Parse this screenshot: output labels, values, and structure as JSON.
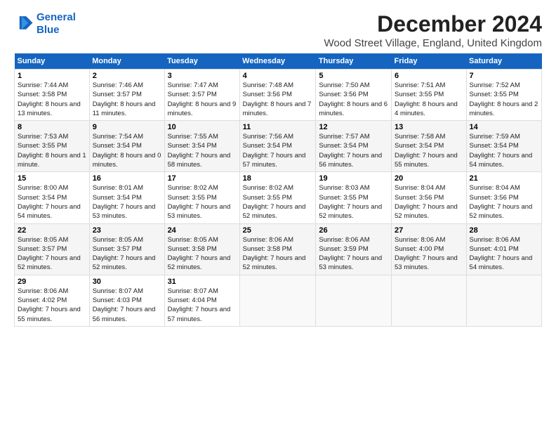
{
  "logo": {
    "line1": "General",
    "line2": "Blue"
  },
  "title": "December 2024",
  "subtitle": "Wood Street Village, England, United Kingdom",
  "days_header": [
    "Sunday",
    "Monday",
    "Tuesday",
    "Wednesday",
    "Thursday",
    "Friday",
    "Saturday"
  ],
  "weeks": [
    [
      {
        "num": "1",
        "sunrise": "7:44 AM",
        "sunset": "3:58 PM",
        "daylight": "8 hours and 13 minutes."
      },
      {
        "num": "2",
        "sunrise": "7:46 AM",
        "sunset": "3:57 PM",
        "daylight": "8 hours and 11 minutes."
      },
      {
        "num": "3",
        "sunrise": "7:47 AM",
        "sunset": "3:57 PM",
        "daylight": "8 hours and 9 minutes."
      },
      {
        "num": "4",
        "sunrise": "7:48 AM",
        "sunset": "3:56 PM",
        "daylight": "8 hours and 7 minutes."
      },
      {
        "num": "5",
        "sunrise": "7:50 AM",
        "sunset": "3:56 PM",
        "daylight": "8 hours and 6 minutes."
      },
      {
        "num": "6",
        "sunrise": "7:51 AM",
        "sunset": "3:55 PM",
        "daylight": "8 hours and 4 minutes."
      },
      {
        "num": "7",
        "sunrise": "7:52 AM",
        "sunset": "3:55 PM",
        "daylight": "8 hours and 2 minutes."
      }
    ],
    [
      {
        "num": "8",
        "sunrise": "7:53 AM",
        "sunset": "3:55 PM",
        "daylight": "8 hours and 1 minute."
      },
      {
        "num": "9",
        "sunrise": "7:54 AM",
        "sunset": "3:54 PM",
        "daylight": "8 hours and 0 minutes."
      },
      {
        "num": "10",
        "sunrise": "7:55 AM",
        "sunset": "3:54 PM",
        "daylight": "7 hours and 58 minutes."
      },
      {
        "num": "11",
        "sunrise": "7:56 AM",
        "sunset": "3:54 PM",
        "daylight": "7 hours and 57 minutes."
      },
      {
        "num": "12",
        "sunrise": "7:57 AM",
        "sunset": "3:54 PM",
        "daylight": "7 hours and 56 minutes."
      },
      {
        "num": "13",
        "sunrise": "7:58 AM",
        "sunset": "3:54 PM",
        "daylight": "7 hours and 55 minutes."
      },
      {
        "num": "14",
        "sunrise": "7:59 AM",
        "sunset": "3:54 PM",
        "daylight": "7 hours and 54 minutes."
      }
    ],
    [
      {
        "num": "15",
        "sunrise": "8:00 AM",
        "sunset": "3:54 PM",
        "daylight": "7 hours and 54 minutes."
      },
      {
        "num": "16",
        "sunrise": "8:01 AM",
        "sunset": "3:54 PM",
        "daylight": "7 hours and 53 minutes."
      },
      {
        "num": "17",
        "sunrise": "8:02 AM",
        "sunset": "3:55 PM",
        "daylight": "7 hours and 53 minutes."
      },
      {
        "num": "18",
        "sunrise": "8:02 AM",
        "sunset": "3:55 PM",
        "daylight": "7 hours and 52 minutes."
      },
      {
        "num": "19",
        "sunrise": "8:03 AM",
        "sunset": "3:55 PM",
        "daylight": "7 hours and 52 minutes."
      },
      {
        "num": "20",
        "sunrise": "8:04 AM",
        "sunset": "3:56 PM",
        "daylight": "7 hours and 52 minutes."
      },
      {
        "num": "21",
        "sunrise": "8:04 AM",
        "sunset": "3:56 PM",
        "daylight": "7 hours and 52 minutes."
      }
    ],
    [
      {
        "num": "22",
        "sunrise": "8:05 AM",
        "sunset": "3:57 PM",
        "daylight": "7 hours and 52 minutes."
      },
      {
        "num": "23",
        "sunrise": "8:05 AM",
        "sunset": "3:57 PM",
        "daylight": "7 hours and 52 minutes."
      },
      {
        "num": "24",
        "sunrise": "8:05 AM",
        "sunset": "3:58 PM",
        "daylight": "7 hours and 52 minutes."
      },
      {
        "num": "25",
        "sunrise": "8:06 AM",
        "sunset": "3:58 PM",
        "daylight": "7 hours and 52 minutes."
      },
      {
        "num": "26",
        "sunrise": "8:06 AM",
        "sunset": "3:59 PM",
        "daylight": "7 hours and 53 minutes."
      },
      {
        "num": "27",
        "sunrise": "8:06 AM",
        "sunset": "4:00 PM",
        "daylight": "7 hours and 53 minutes."
      },
      {
        "num": "28",
        "sunrise": "8:06 AM",
        "sunset": "4:01 PM",
        "daylight": "7 hours and 54 minutes."
      }
    ],
    [
      {
        "num": "29",
        "sunrise": "8:06 AM",
        "sunset": "4:02 PM",
        "daylight": "7 hours and 55 minutes."
      },
      {
        "num": "30",
        "sunrise": "8:07 AM",
        "sunset": "4:03 PM",
        "daylight": "7 hours and 56 minutes."
      },
      {
        "num": "31",
        "sunrise": "8:07 AM",
        "sunset": "4:04 PM",
        "daylight": "7 hours and 57 minutes."
      },
      null,
      null,
      null,
      null
    ]
  ]
}
